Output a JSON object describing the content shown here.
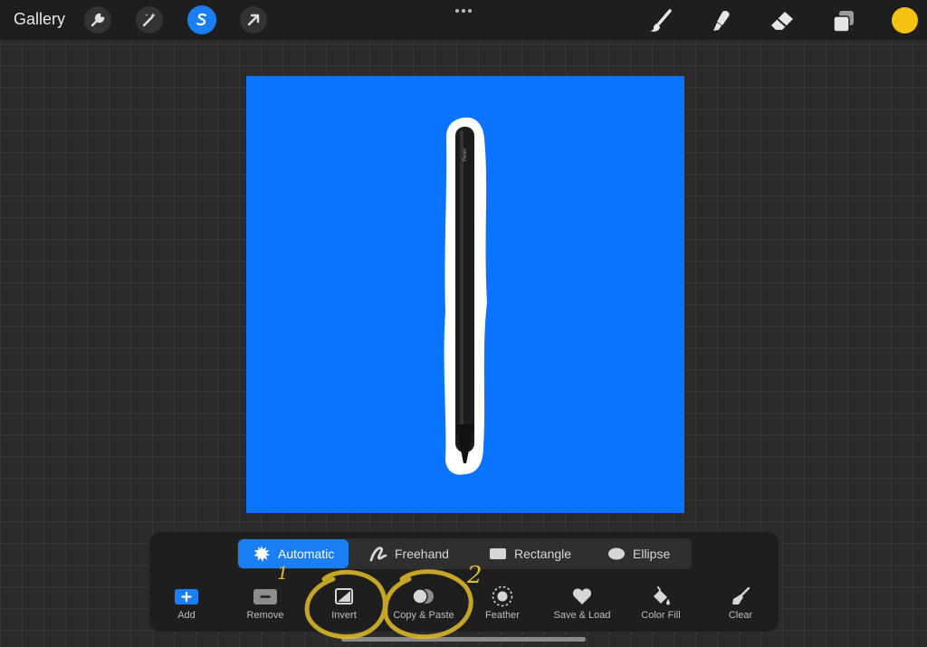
{
  "topbar": {
    "gallery_label": "Gallery",
    "left_tools": [
      {
        "icon": "wrench-icon",
        "label": "Actions"
      },
      {
        "icon": "magic-wand-icon",
        "label": "Adjustments"
      },
      {
        "icon": "selection-icon",
        "label": "Selection",
        "active": true
      },
      {
        "icon": "arrow-icon",
        "label": "Transform"
      }
    ],
    "right_tools": [
      {
        "icon": "brush-icon"
      },
      {
        "icon": "smudge-icon"
      },
      {
        "icon": "eraser-icon"
      },
      {
        "icon": "layers-icon"
      }
    ],
    "current_color": "#f5c211"
  },
  "canvas": {
    "background_color": "#0a74ff",
    "pencil_text": "Pencil"
  },
  "selection_panel": {
    "modes": [
      {
        "label": "Automatic",
        "icon": "burst-icon",
        "active": true
      },
      {
        "label": "Freehand",
        "icon": "freehand-icon"
      },
      {
        "label": "Rectangle",
        "icon": "rectangle-icon"
      },
      {
        "label": "Ellipse",
        "icon": "ellipse-icon"
      }
    ],
    "actions": [
      {
        "label": "Add",
        "icon": "plus-icon"
      },
      {
        "label": "Remove",
        "icon": "minus-icon"
      },
      {
        "label": "Invert",
        "icon": "invert-icon"
      },
      {
        "label": "Copy & Paste",
        "icon": "copy-paste-icon"
      },
      {
        "label": "Feather",
        "icon": "feather-icon"
      },
      {
        "label": "Save & Load",
        "icon": "heart-icon"
      },
      {
        "label": "Color Fill",
        "icon": "fill-bucket-icon"
      },
      {
        "label": "Clear",
        "icon": "clear-brush-icon"
      }
    ]
  },
  "annotations": {
    "mark_1": "1",
    "mark_2": "2",
    "color": "#e2bd2a"
  }
}
